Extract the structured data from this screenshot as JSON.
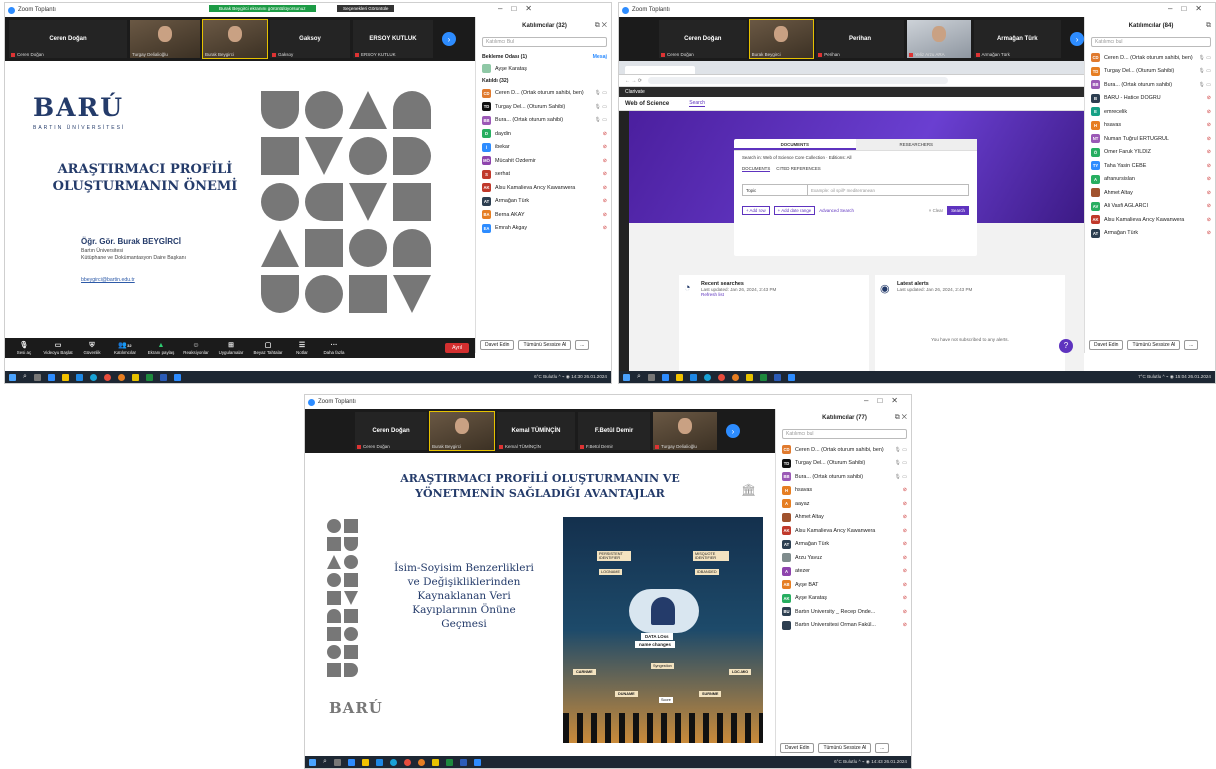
{
  "s1": {
    "title": "Zoom Toplantı",
    "banner_green": "Burak Beygirci ekranını görüntülüyorsunuz",
    "banner_dark": "Seçenekleri Görüntüle",
    "tiles": [
      {
        "name": "Ceren Doğan",
        "sub": "Ceren Doğan"
      },
      {
        "name": "",
        "sub": "Turgay Delialioğlu"
      },
      {
        "name": "",
        "sub": "Burak Beygirci"
      },
      {
        "name": "Gaksoy",
        "sub": "Gaksoy"
      },
      {
        "name": "ERSOY KUTLUK",
        "sub": "ERSOY KUTLUK"
      }
    ],
    "slide": {
      "logo": "BARÚ",
      "univ": "BARTIN ÜNİVERSİTESİ",
      "title1": "ARAŞTIRMACI PROFİLİ",
      "title2": "OLUŞTURMANIN ÖNEMİ",
      "presenter": "Öğr. Gör. Burak BEYGİRCİ",
      "aff1": "Bartın Üniversitesi",
      "aff2": "Kütüphane ve Dokümantasyon Daire Başkanı",
      "email": "bbeygirci@bartin.edu.tr"
    },
    "panel": {
      "title": "Katılımcılar (32)",
      "search": "Katılımcı Bul",
      "waiting": "Bekleme Odası (1)",
      "mesaj": "Mesaj",
      "waiting_person": {
        "initials": "",
        "name": "Ayşe Karataş",
        "color": "#8fc8a6"
      },
      "joined": "Katıldı (32)",
      "people": [
        {
          "initials": "CD",
          "name": "Ceren D... (Ortak oturum sahibi, ben)",
          "color": "#e07a2e"
        },
        {
          "initials": "TD",
          "name": "Turgay Del... (Oturum Sahibi)",
          "color": "#111111"
        },
        {
          "initials": "BB",
          "name": "Bura... (Ortak oturum sahibi)",
          "color": "#9b59b6"
        },
        {
          "initials": "D",
          "name": "daydin",
          "color": "#27ae60"
        },
        {
          "initials": "İ",
          "name": "ibekar",
          "color": "#2d8cff"
        },
        {
          "initials": "MÖ",
          "name": "Mücahit Özdemir",
          "color": "#8e44ad"
        },
        {
          "initials": "S",
          "name": "serhat",
          "color": "#c0392b"
        },
        {
          "initials": "AK",
          "name": "Alsu Kamalieva Arıcy Kawanwera",
          "color": "#c0392b"
        },
        {
          "initials": "AT",
          "name": "Armağan Türk",
          "color": "#2c3e50"
        },
        {
          "initials": "BA",
          "name": "Berna AKAY",
          "color": "#e67e22"
        },
        {
          "initials": "EA",
          "name": "Emrah Akgay",
          "color": "#2d8cff"
        }
      ],
      "invite": "Davet Edin",
      "mute_all": "Tümünü Sessize Al",
      "more": "..."
    },
    "controls": [
      "Sesi aç",
      "Videoyu Başlat",
      "Güvenlik",
      "Katılımcılar",
      "Ekranı paylaş",
      "Reaksiyonlar",
      "Uygulamalar",
      "Beyaz Tahtalar",
      "Notlar",
      "Daha fazla"
    ],
    "participants_count": "32",
    "leave": "Ayrıl",
    "tray": "6°C Bulutlu",
    "time": "14:30",
    "date": "26.01.2024"
  },
  "s2": {
    "title": "Zoom Toplantı",
    "tiles": [
      {
        "name": "Ceren Doğan",
        "sub": "Ceren Doğan"
      },
      {
        "name": "",
        "sub": "Burak Beygirci"
      },
      {
        "name": "Perihan",
        "sub": "Perihan"
      },
      {
        "name": "",
        "sub": "Yeliz Arzu ARA"
      },
      {
        "name": "Armağan Türk",
        "sub": "Armağan Türk"
      }
    ],
    "wos": {
      "brand": "Clarivate",
      "product": "Web of Science",
      "nav_search": "Search",
      "tab_docs": "DOCUMENTS",
      "tab_researchers": "RESEARCHERS",
      "search_in": "Search in: Web of Science Core Collection",
      "editions": "Editions: All",
      "subtab_docs": "DOCUMENTS",
      "subtab_cited": "CITED REFERENCES",
      "field": "Topic",
      "example": "Example: oil spill* mediterranean",
      "add_row": "+ Add row",
      "add_date": "+ Add date range",
      "advanced": "Advanced Search",
      "clear": "× Clear",
      "search_btn": "Search",
      "recent": "Recent searches",
      "recent_sub": "Last updated: Jan 26, 2024, 2:43 PM",
      "refresh": "Refresh list",
      "alerts": "Latest alerts",
      "alerts_sub": "Last updated: Jan 26, 2024, 2:43 PM",
      "alerts_empty": "You have not subscribed to any alerts."
    },
    "panel": {
      "title": "Katılımcılar (84)",
      "search": "Katılımcı bul",
      "people": [
        {
          "initials": "CD",
          "name": "Ceren D... (Ortak oturum sahibi, ben)",
          "color": "#e07a2e"
        },
        {
          "initials": "TD",
          "name": "Turgay Del... (Oturum Sahibi)",
          "color": "#e67e22"
        },
        {
          "initials": "BB",
          "name": "Bura... (Ortak oturum sahibi)",
          "color": "#9b59b6"
        },
        {
          "initials": "B",
          "name": "BARÜ - Hatice DOĞRU",
          "color": "#2c3e50"
        },
        {
          "initials": "E",
          "name": "emrecelik",
          "color": "#16a085"
        },
        {
          "initials": "H",
          "name": "hsavas",
          "color": "#e67e22"
        },
        {
          "initials": "NT",
          "name": "Numan Tuğrul ERTUĞRUL",
          "color": "#9b59b6"
        },
        {
          "initials": "Ö",
          "name": "Ömer Faruk YILDIZ",
          "color": "#27ae60"
        },
        {
          "initials": "TY",
          "name": "Taha Yasin CEBE",
          "color": "#2d8cff"
        },
        {
          "initials": "A",
          "name": "afranursislan",
          "color": "#27ae60"
        },
        {
          "initials": "",
          "name": "Ahmet Altay",
          "color": "#a0522d"
        },
        {
          "initials": "AV",
          "name": "Ali Vasfi AĞLARCI",
          "color": "#27ae60"
        },
        {
          "initials": "AK",
          "name": "Alsu Kamalieva Arıcy Kawanwera",
          "color": "#c0392b"
        },
        {
          "initials": "AT",
          "name": "Armağan Türk",
          "color": "#2c3e50"
        }
      ],
      "invite": "Davet Edin",
      "mute_all": "Tümünü Sessize Al",
      "more": "..."
    },
    "tray": "7°C Bulutlu",
    "time": "15:04",
    "date": "26.01.2024"
  },
  "s3": {
    "title": "Zoom Toplantı",
    "tiles": [
      {
        "name": "Ceren Doğan",
        "sub": "Ceren Doğan"
      },
      {
        "name": "",
        "sub": "Burak Beygirci"
      },
      {
        "name": "Kemal TÜMİNÇİN",
        "sub": "Kemal TÜMİNÇİN"
      },
      {
        "name": "F.Betül Demir",
        "sub": "F.Betül Demir"
      },
      {
        "name": "",
        "sub": "Turgay Delialioğlu"
      }
    ],
    "slide": {
      "title1": "ARAŞTIRMACI PROFİLİ OLUŞTURMANIN VE",
      "title2": "YÖNETMENİN SAĞLADIĞI AVANTAJLAR",
      "bullet": [
        "İsim-Soyisim Benzerlikleri",
        "ve Değişikliklerinden",
        "Kaynaklanan Veri",
        "Kayıplarının Önüne",
        "Geçmesi"
      ],
      "logo": "BARÚ",
      "img_labels": [
        "PERSISTENT IDENTIFIER",
        "LOGNAME",
        "MISQUOTE IDENTIFIER",
        "IDBANDED",
        "DATA LOss",
        "name changes",
        "Syngestion",
        "CARNME",
        "DUNAME",
        "SURNME",
        "LDC-MIO",
        "Score"
      ]
    },
    "panel": {
      "title": "Katılımcılar (77)",
      "search": "Katılımcı bul",
      "people": [
        {
          "initials": "CD",
          "name": "Ceren D... (Ortak oturum sahibi, ben)",
          "color": "#e07a2e"
        },
        {
          "initials": "TD",
          "name": "Turgay Del... (Oturum Sahibi)",
          "color": "#111111"
        },
        {
          "initials": "BB",
          "name": "Bura... (Ortak oturum sahibi)",
          "color": "#9b59b6"
        },
        {
          "initials": "H",
          "name": "hsavas",
          "color": "#e67e22"
        },
        {
          "initials": "A",
          "name": "aayaz",
          "color": "#e67e22"
        },
        {
          "initials": "",
          "name": "Ahmet Altay",
          "color": "#a0522d"
        },
        {
          "initials": "AK",
          "name": "Alsu Kamalieva Arıcy Kawanwera",
          "color": "#c0392b"
        },
        {
          "initials": "AT",
          "name": "Armağan Türk",
          "color": "#2c3e50"
        },
        {
          "initials": "",
          "name": "Arzu Yavuz",
          "color": "#7f8c8d"
        },
        {
          "initials": "A",
          "name": "atezer",
          "color": "#8e44ad"
        },
        {
          "initials": "AB",
          "name": "Ayşe BAT",
          "color": "#e67e22"
        },
        {
          "initials": "AK",
          "name": "Ayşe Karataş",
          "color": "#27ae60"
        },
        {
          "initials": "BU",
          "name": "Bartın University _ Recep Önde...",
          "color": "#2c3e50"
        },
        {
          "initials": "",
          "name": "Bartın Üniversitesi Orman Fakül...",
          "color": "#2c3e50"
        }
      ],
      "invite": "Davet Edin",
      "mute_all": "Tümünü Sessize Al",
      "more": "..."
    },
    "tray": "6°C Bulutlu",
    "time": "14:43",
    "date": "26.01.2024"
  }
}
